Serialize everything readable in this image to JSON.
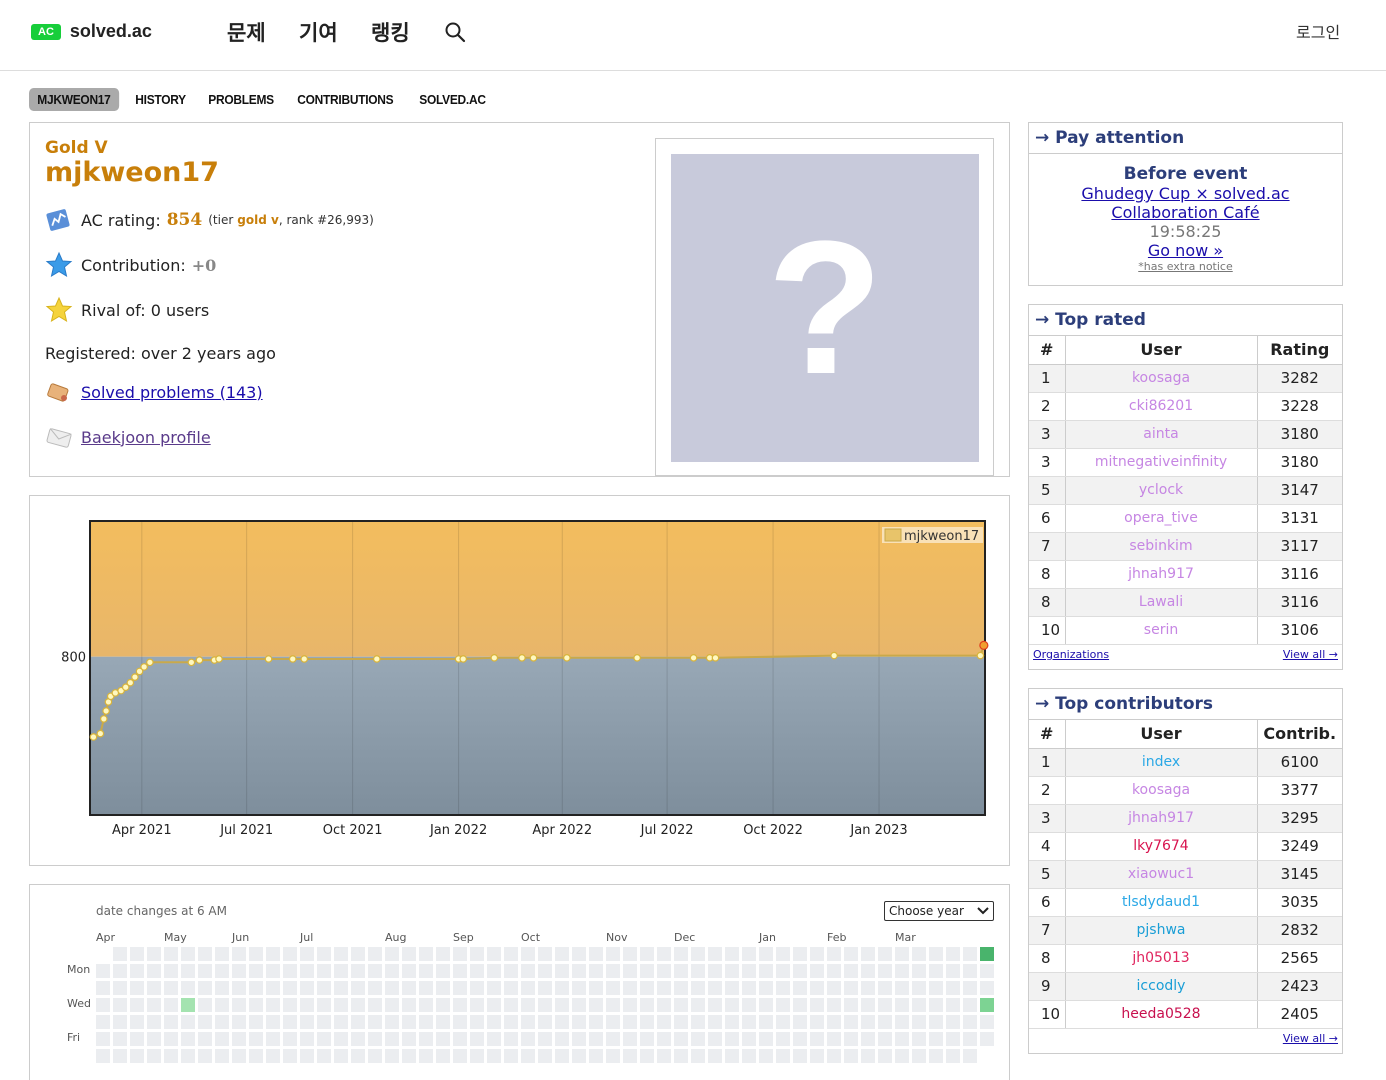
{
  "header": {
    "logo_badge": "AC",
    "logo_text": "solved.ac",
    "nav": [
      "문제",
      "기여",
      "랭킹"
    ],
    "login": "로그인"
  },
  "tabs": [
    "MJKWEON17",
    "HISTORY",
    "PROBLEMS",
    "CONTRIBUTIONS",
    "SOLVED.AC"
  ],
  "profile": {
    "tier": "Gold V",
    "username": "mjkweon17",
    "ac_rating_label": "AC rating:",
    "ac_rating": "854",
    "tier_open": "(tier",
    "tier_name": "gold v",
    "rank_text": ", rank #26,993)",
    "contribution_label": "Contribution:",
    "contribution": "+0",
    "rival": "Rival of: 0 users",
    "registered": "Registered: over 2 years ago",
    "solved_link": "Solved problems (143)",
    "baekjoon_link": "Baekjoon profile",
    "avatar_glyph": "?"
  },
  "chart_data": {
    "type": "area",
    "legend": "mjkweon17",
    "legend_position": "top-right",
    "y_tick": "800",
    "x_ticks": [
      "Apr 2021",
      "Jul 2021",
      "Oct 2021",
      "Jan 2022",
      "Apr 2022",
      "Jul 2022",
      "Oct 2022",
      "Jan 2023"
    ],
    "ylim": [
      660,
      920
    ],
    "gold_threshold": 800,
    "grid": true,
    "series": [
      {
        "name": "mjkweon17",
        "points": [
          [
            "2021-02-18",
            729
          ],
          [
            "2021-02-24",
            732
          ],
          [
            "2021-02-27",
            745
          ],
          [
            "2021-03-01",
            752
          ],
          [
            "2021-03-03",
            760
          ],
          [
            "2021-03-05",
            765
          ],
          [
            "2021-03-09",
            768
          ],
          [
            "2021-03-14",
            770
          ],
          [
            "2021-03-18",
            773
          ],
          [
            "2021-03-22",
            777
          ],
          [
            "2021-03-26",
            782
          ],
          [
            "2021-03-30",
            787
          ],
          [
            "2021-04-03",
            791
          ],
          [
            "2021-04-08",
            795
          ],
          [
            "2021-05-14",
            795
          ],
          [
            "2021-05-21",
            797
          ],
          [
            "2021-06-03",
            797
          ],
          [
            "2021-06-07",
            798
          ],
          [
            "2021-07-20",
            798
          ],
          [
            "2021-08-10",
            798
          ],
          [
            "2021-08-20",
            798
          ],
          [
            "2021-10-22",
            798
          ],
          [
            "2022-01-01",
            798
          ],
          [
            "2022-01-05",
            798
          ],
          [
            "2022-02-01",
            799
          ],
          [
            "2022-02-25",
            799
          ],
          [
            "2022-03-07",
            799
          ],
          [
            "2022-04-05",
            799
          ],
          [
            "2022-06-05",
            799
          ],
          [
            "2022-07-24",
            799
          ],
          [
            "2022-08-07",
            799
          ],
          [
            "2022-08-12",
            799
          ],
          [
            "2022-11-23",
            801
          ],
          [
            "2023-03-30",
            801
          ],
          [
            "2023-04-02",
            810
          ]
        ]
      }
    ]
  },
  "side": {
    "pay_attention": {
      "title": "→ Pay attention",
      "head": "Before event",
      "link1": "Ghudegy Cup × solved.ac",
      "link2": "Collaboration Café",
      "timer": "19:58:25",
      "go": "Go now »",
      "note": "*has extra notice"
    },
    "top_rated": {
      "title": "→ Top rated",
      "headers": [
        "#",
        "User",
        "Rating"
      ],
      "rows": [
        {
          "n": "1",
          "user": "koosaga",
          "v": "3282",
          "color": "#c686e3"
        },
        {
          "n": "2",
          "user": "cki86201",
          "v": "3228",
          "color": "#c686e3"
        },
        {
          "n": "3",
          "user": "ainta",
          "v": "3180",
          "color": "#c686e3"
        },
        {
          "n": "3",
          "user": "mitnegativeinfinity",
          "v": "3180",
          "color": "#c686e3"
        },
        {
          "n": "5",
          "user": "yclock",
          "v": "3147",
          "color": "#c686e3"
        },
        {
          "n": "6",
          "user": "opera_tive",
          "v": "3131",
          "color": "#c686e3"
        },
        {
          "n": "7",
          "user": "sebinkim",
          "v": "3117",
          "color": "#c686e3"
        },
        {
          "n": "8",
          "user": "jhnah917",
          "v": "3116",
          "color": "#c686e3"
        },
        {
          "n": "8",
          "user": "Lawali",
          "v": "3116",
          "color": "#c686e3"
        },
        {
          "n": "10",
          "user": "serin",
          "v": "3106",
          "color": "#c686e3"
        }
      ],
      "foot_left": "Organizations",
      "foot_right": "View all →"
    },
    "top_contrib": {
      "title": "→ Top contributors",
      "headers": [
        "#",
        "User",
        "Contrib."
      ],
      "rows": [
        {
          "n": "1",
          "user": "index",
          "v": "6100",
          "color": "#2ba8e6"
        },
        {
          "n": "2",
          "user": "koosaga",
          "v": "3377",
          "color": "#c686e3"
        },
        {
          "n": "3",
          "user": "jhnah917",
          "v": "3295",
          "color": "#c686e3"
        },
        {
          "n": "4",
          "user": "lky7674",
          "v": "3249",
          "color": "#d8144f"
        },
        {
          "n": "5",
          "user": "xiaowuc1",
          "v": "3145",
          "color": "#c686e3"
        },
        {
          "n": "6",
          "user": "tlsdydaud1",
          "v": "3035",
          "color": "#2ba8e6"
        },
        {
          "n": "7",
          "user": "pjshwa",
          "v": "2832",
          "color": "#1a9ed6"
        },
        {
          "n": "8",
          "user": "jh05013",
          "v": "2565",
          "color": "#e0245e"
        },
        {
          "n": "9",
          "user": "iccodly",
          "v": "2423",
          "color": "#1a9ed6"
        },
        {
          "n": "10",
          "user": "heeda0528",
          "v": "2405",
          "color": "#c8104e"
        }
      ],
      "foot_right": "View all →"
    }
  },
  "heatmap": {
    "note": "date changes at 6 AM",
    "select": "Choose year",
    "months": [
      "Apr",
      "May",
      "Jun",
      "Jul",
      "Aug",
      "Sep",
      "Oct",
      "Nov",
      "Dec",
      "Jan",
      "Feb",
      "Mar"
    ],
    "days": [
      "Mon",
      "Wed",
      "Fri"
    ],
    "filled": [
      {
        "week": 5,
        "day": 3,
        "level": "light"
      },
      {
        "week": 52,
        "day": 0,
        "level": "dark"
      },
      {
        "week": 52,
        "day": 3,
        "level": "mid"
      }
    ]
  }
}
